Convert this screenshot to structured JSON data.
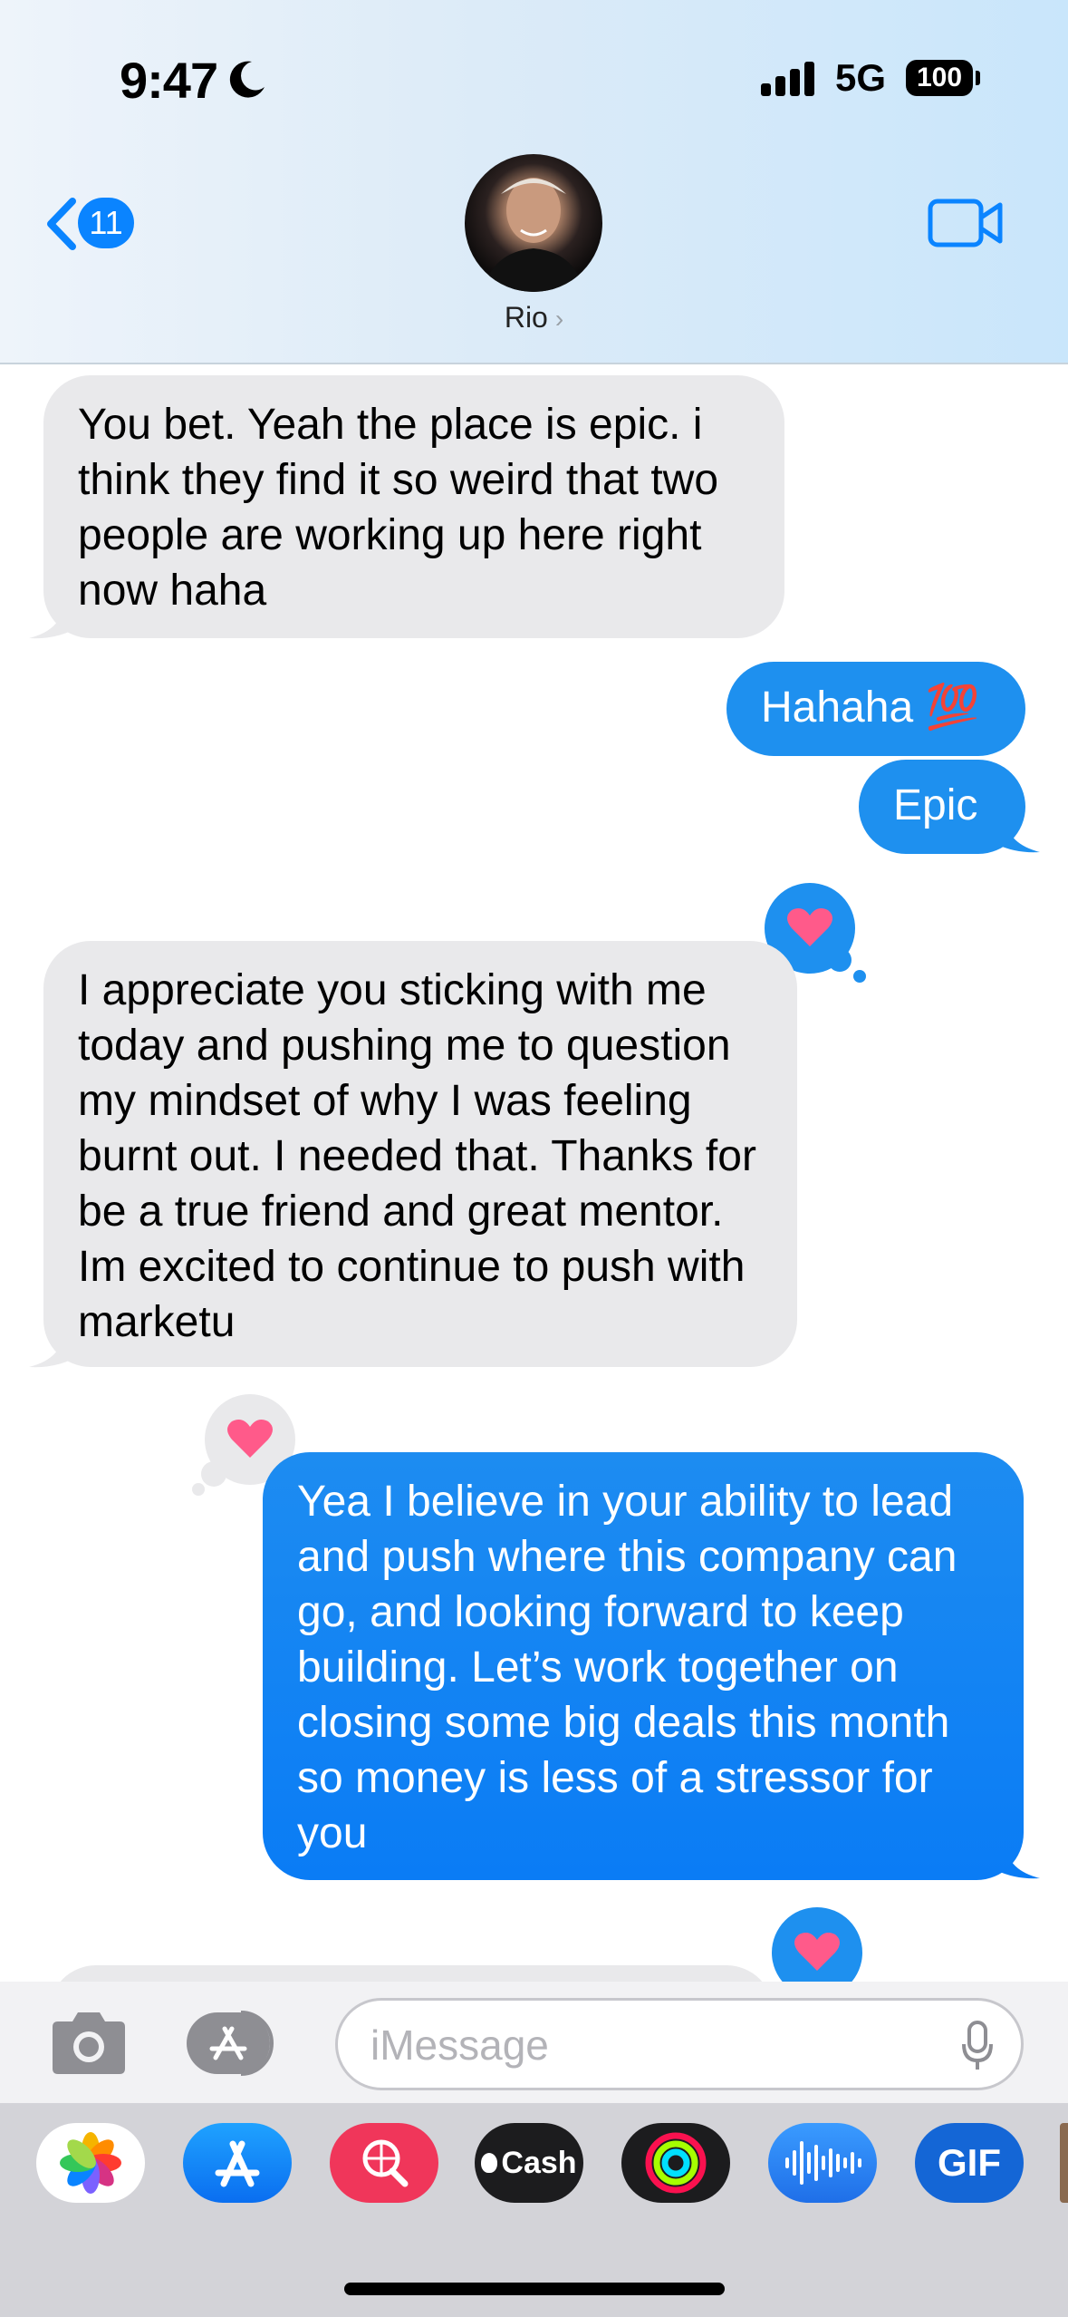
{
  "status_bar": {
    "time": "9:47",
    "network": "5G",
    "battery": "100"
  },
  "header": {
    "back_count": "11",
    "contact_name": "Rio",
    "chevron": "›"
  },
  "messages": [
    {
      "side": "received",
      "text": "You bet. Yeah the place is epic. i think they find it so weird that two people are working up here right now haha"
    },
    {
      "side": "sent",
      "text": "Hahaha 💯"
    },
    {
      "side": "sent",
      "text": "Epic"
    },
    {
      "side": "received",
      "text": "I appreciate you sticking with me today and pushing me to question my mindset of why I was feeling burnt out. I needed that. Thanks for be a true friend and great mentor. Im excited to continue to push with marketu"
    },
    {
      "side": "sent",
      "text": "Yea I believe in your ability to lead and push where this company can go, and looking forward to keep building. Let’s work together on closing some big deals this month so money is less of a stressor for you"
    }
  ],
  "tapbacks": [
    "heart",
    "heart",
    "heart"
  ],
  "input": {
    "placeholder": "iMessage"
  },
  "apps": [
    "Photos",
    "App Store",
    "Search",
    "Cash",
    "Fitness",
    "Voice",
    "GIF"
  ],
  "apps_labels": {
    "cash": "Cash",
    "gif": "GIF"
  },
  "colors": {
    "sent_bubble": "#0a84ff",
    "received_bubble": "#e9e9eb",
    "heart": "#ff5a8a"
  }
}
